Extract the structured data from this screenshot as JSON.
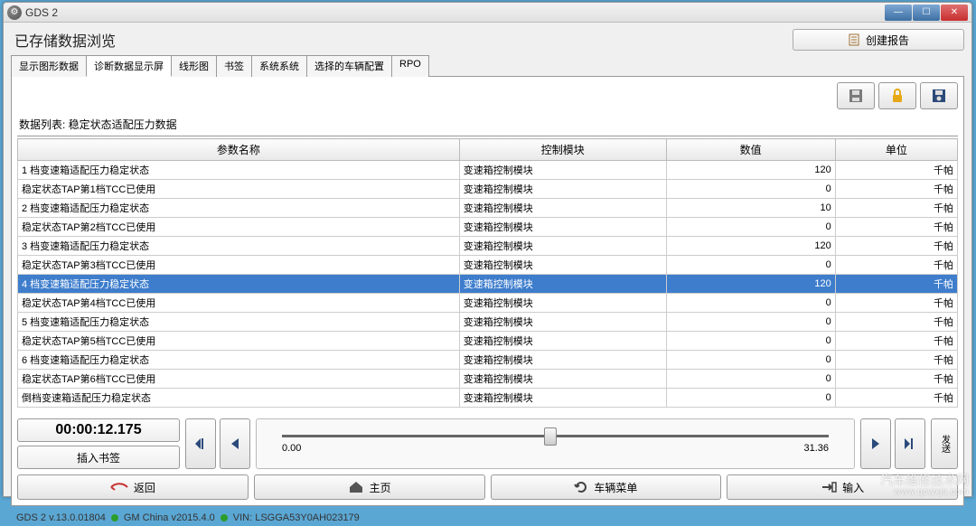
{
  "window": {
    "title": "GDS 2"
  },
  "header": {
    "page_title": "已存储数据浏览",
    "create_report_label": "创建报告"
  },
  "tabs": [
    {
      "label": "显示图形数据",
      "active": false
    },
    {
      "label": "诊断数据显示屏",
      "active": true
    },
    {
      "label": "线形图",
      "active": false
    },
    {
      "label": "书签",
      "active": false
    },
    {
      "label": "系统系统",
      "active": false
    },
    {
      "label": "选择的车辆配置",
      "active": false
    },
    {
      "label": "RPO",
      "active": false
    }
  ],
  "data_list_label": "数据列表: 稳定状态适配压力数据",
  "columns": {
    "param": "参数名称",
    "module": "控制模块",
    "value": "数值",
    "unit": "单位"
  },
  "rows": [
    {
      "param": "1 档变速箱适配压力稳定状态",
      "module": "变速箱控制模块",
      "value": "120",
      "unit": "千帕",
      "selected": false
    },
    {
      "param": "稳定状态TAP第1档TCC已使用",
      "module": "变速箱控制模块",
      "value": "0",
      "unit": "千帕",
      "selected": false
    },
    {
      "param": "2 档变速箱适配压力稳定状态",
      "module": "变速箱控制模块",
      "value": "10",
      "unit": "千帕",
      "selected": false
    },
    {
      "param": "稳定状态TAP第2档TCC已使用",
      "module": "变速箱控制模块",
      "value": "0",
      "unit": "千帕",
      "selected": false
    },
    {
      "param": "3 档变速箱适配压力稳定状态",
      "module": "变速箱控制模块",
      "value": "120",
      "unit": "千帕",
      "selected": false
    },
    {
      "param": "稳定状态TAP第3档TCC已使用",
      "module": "变速箱控制模块",
      "value": "0",
      "unit": "千帕",
      "selected": false
    },
    {
      "param": "4 档变速箱适配压力稳定状态",
      "module": "变速箱控制模块",
      "value": "120",
      "unit": "千帕",
      "selected": true
    },
    {
      "param": "稳定状态TAP第4档TCC已使用",
      "module": "变速箱控制模块",
      "value": "0",
      "unit": "千帕",
      "selected": false
    },
    {
      "param": "5 档变速箱适配压力稳定状态",
      "module": "变速箱控制模块",
      "value": "0",
      "unit": "千帕",
      "selected": false
    },
    {
      "param": "稳定状态TAP第5档TCC已使用",
      "module": "变速箱控制模块",
      "value": "0",
      "unit": "千帕",
      "selected": false
    },
    {
      "param": "6 档变速箱适配压力稳定状态",
      "module": "变速箱控制模块",
      "value": "0",
      "unit": "千帕",
      "selected": false
    },
    {
      "param": "稳定状态TAP第6档TCC已使用",
      "module": "变速箱控制模块",
      "value": "0",
      "unit": "千帕",
      "selected": false
    },
    {
      "param": "倒档变速箱适配压力稳定状态",
      "module": "变速箱控制模块",
      "value": "0",
      "unit": "千帕",
      "selected": false
    }
  ],
  "playback": {
    "time": "00:00:12.175",
    "bookmark_label": "插入书签",
    "slider_min": "0.00",
    "slider_max": "31.36",
    "send_label": "发送"
  },
  "bottom_nav": {
    "back": "返回",
    "home": "主页",
    "vehicle_menu": "车辆菜单",
    "input": "输入"
  },
  "statusbar": {
    "version": "GDS 2 v.13.0.01804",
    "region": "GM China v2015.4.0",
    "vin": "VIN: LSGGA53Y0AH023179"
  },
  "watermark": {
    "main": "汽车维修技术网",
    "sub": "www.qcwxjs.com"
  }
}
